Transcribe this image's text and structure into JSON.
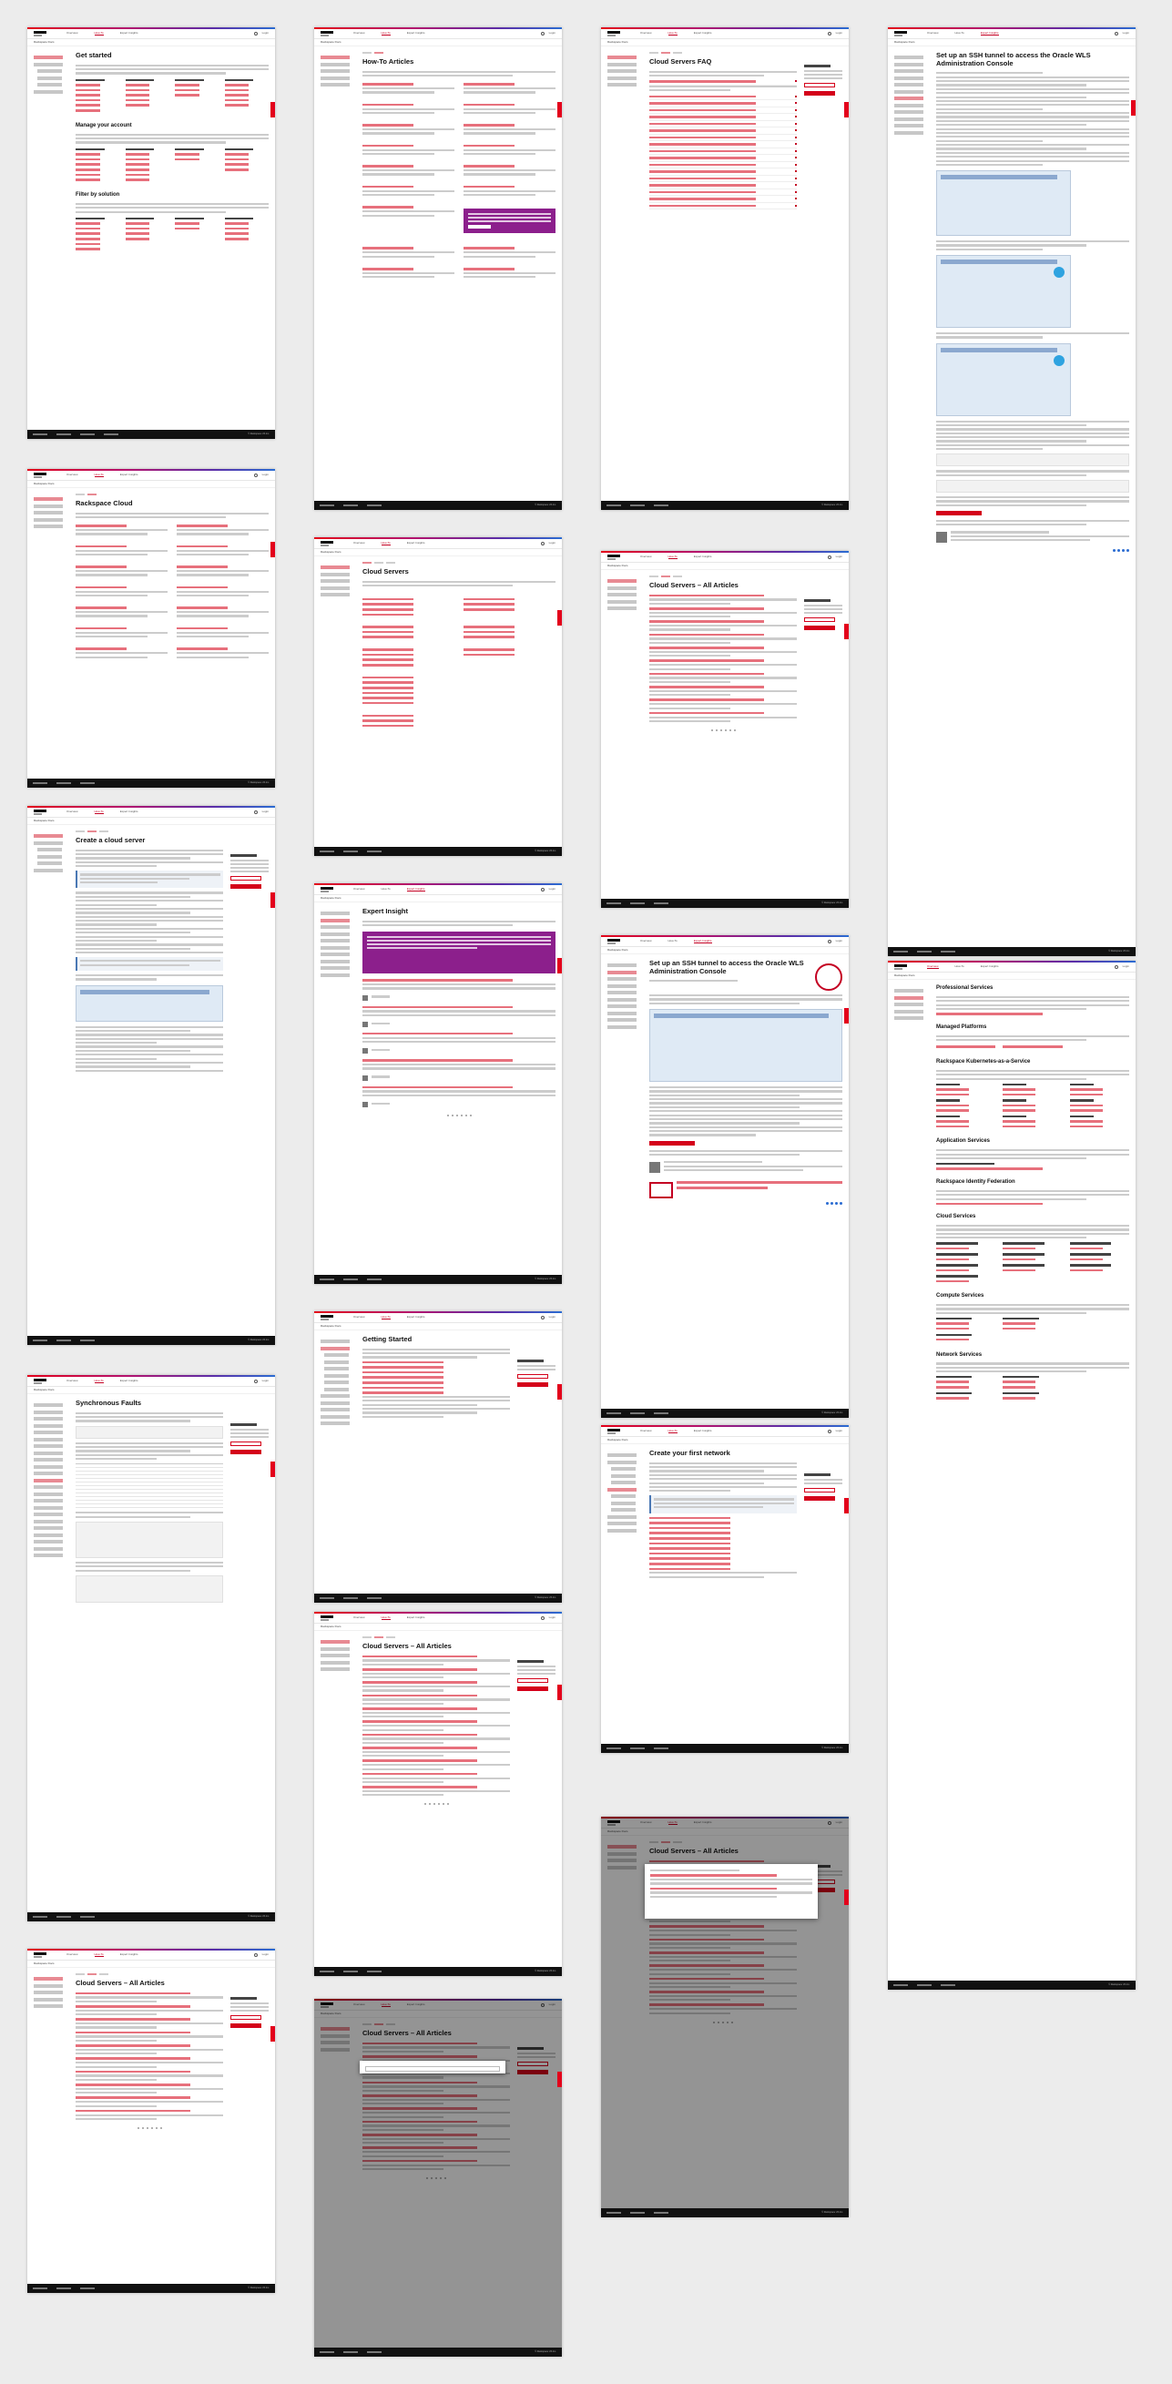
{
  "site": {
    "logo_text": "Rackspace Docs",
    "nav": [
      "Overview",
      "How-To",
      "Expert Insights",
      "Support"
    ],
    "login": "Login",
    "footer_left": "© Rackspace US Inc."
  },
  "pages": {
    "get_started": {
      "title": "Get started",
      "sections": [
        "Manage your account",
        "Filter by solution"
      ],
      "columns": [
        "Applications",
        "Cloud Platforms",
        "Data",
        "Security"
      ]
    },
    "how_to": {
      "title": "How-To Articles"
    },
    "faq": {
      "title": "Cloud Servers FAQ"
    },
    "ssh_tunnel": {
      "title": "Set up an SSH tunnel to access the Oracle WLS Administration Console"
    },
    "rackspace_cloud": {
      "title": "Rackspace Cloud"
    },
    "cloud_servers": {
      "title": "Cloud Servers"
    },
    "all_articles": {
      "title": "Cloud Servers – All Articles"
    },
    "create_server": {
      "title": "Create a cloud server"
    },
    "expert_insight": {
      "title": "Expert Insight"
    },
    "professional_services": {
      "title": "Professional Services",
      "sections": [
        "Managed Platforms",
        "Rackspace Kubernetes-as-a-Service",
        "Application Services",
        "Rackspace Identity Federation",
        "Cloud Services",
        "Compute Services",
        "Network Services"
      ]
    },
    "getting_started": {
      "title": "Getting Started"
    },
    "create_network": {
      "title": "Create your first network"
    },
    "synchronous_faults": {
      "title": "Synchronous Faults"
    }
  },
  "related": {
    "title": "Related Articles"
  },
  "colors": {
    "brand_red": "#e3001b",
    "promo_purple": "#8c1f8c",
    "footer": "#111111"
  }
}
